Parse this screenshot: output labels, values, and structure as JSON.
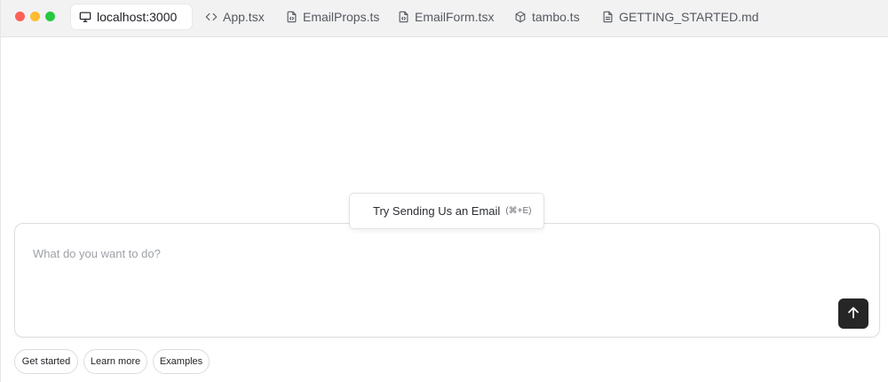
{
  "window": {
    "traffic_lights": [
      "close",
      "minimize",
      "zoom"
    ],
    "colors": {
      "close": "#fe5f57",
      "minimize": "#febc2e",
      "zoom": "#28c840"
    }
  },
  "tabs": [
    {
      "label": "localhost:3000",
      "icon": "monitor-icon",
      "active": true
    },
    {
      "label": "App.tsx",
      "icon": "code-icon",
      "active": false
    },
    {
      "label": "EmailProps.ts",
      "icon": "file-code-icon",
      "active": false
    },
    {
      "label": "EmailForm.tsx",
      "icon": "file-code-icon",
      "active": false
    },
    {
      "label": "tambo.ts",
      "icon": "box-icon",
      "active": false
    },
    {
      "label": "GETTING_STARTED.md",
      "icon": "file-text-icon",
      "active": false
    }
  ],
  "suggestion": {
    "label": "Try Sending Us an Email",
    "shortcut": "(⌘+E)"
  },
  "prompt": {
    "placeholder": "What do you want to do?",
    "value": "",
    "send_icon": "arrow-up-icon",
    "send_color": "#262626"
  },
  "pills": [
    {
      "label": "Get started"
    },
    {
      "label": "Learn more"
    },
    {
      "label": "Examples"
    }
  ]
}
